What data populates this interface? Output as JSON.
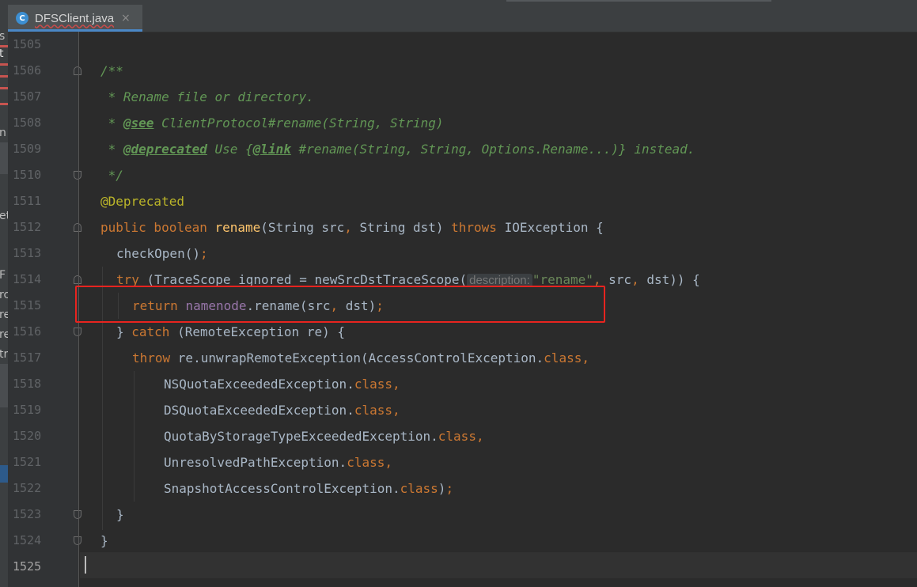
{
  "tab": {
    "icon_letter": "C",
    "filename": "DFSClient.java",
    "close_glyph": "×",
    "icon": "class-c-icon",
    "accent": "#4a88c7"
  },
  "left_strip": {
    "fragments": [
      "s",
      "t",
      "n",
      "et",
      "F",
      "rc",
      "re",
      "re",
      "tr"
    ]
  },
  "editor": {
    "current_line": "1525",
    "colors": {
      "keyword": "#cc7832",
      "doc_comment": "#629755",
      "annotation": "#bbb529",
      "method": "#ffc66d",
      "string": "#6a8759",
      "field": "#9876aa",
      "highlight_box": "#e8241f"
    },
    "line_numbers": [
      "1505",
      "1506",
      "1507",
      "1508",
      "1509",
      "1510",
      "1511",
      "1512",
      "1513",
      "1514",
      "1515",
      "1516",
      "1517",
      "1518",
      "1519",
      "1520",
      "1521",
      "1522",
      "1523",
      "1524",
      "1525"
    ],
    "code": {
      "l1506": "/**",
      "l1507": " * Rename file or directory.",
      "l1508a": " * ",
      "l1508tag": "@see",
      "l1508b": " ClientProtocol#rename(String, String)",
      "l1509a": " * ",
      "l1509tag": "@deprecated",
      "l1509b": " Use {",
      "l1509link": "@link",
      "l1509c": " #rename(String, String, Options.Rename...)} instead.",
      "l1510": " */",
      "l1511": "@Deprecated",
      "l1512kw": "public boolean ",
      "l1512fn": "rename",
      "l1512a": "(String src",
      "l1512comma": ", ",
      "l1512b": "String dst) ",
      "l1512throws": "throws ",
      "l1512c": "IOException {",
      "l1513a": "checkOpen()",
      "l1513semi": ";",
      "l1514kw": "try ",
      "l1514a": "(TraceScope ignored = newSrcDstTraceScope(",
      "l1514hint": "description:",
      "l1514str": "\"rename\"",
      "l1514comma": ", ",
      "l1514b": "src",
      "l1514comma2": ", ",
      "l1514c": "dst)) {",
      "l1515kw": "return ",
      "l1515fld": "namenode",
      "l1515a": ".rename(src",
      "l1515comma": ", ",
      "l1515b": "dst)",
      "l1515semi": ";",
      "l1516a": "} ",
      "l1516kw": "catch ",
      "l1516b": "(RemoteException re) {",
      "l1517kw": "throw ",
      "l1517a": "re.unwrapRemoteException(AccessControlException.",
      "l1517cls": "class,",
      "l1518a": "NSQuotaExceededException.",
      "l1518cls": "class,",
      "l1519a": "DSQuotaExceededException.",
      "l1519cls": "class,",
      "l1520a": "QuotaByStorageTypeExceededException.",
      "l1520cls": "class,",
      "l1521a": "UnresolvedPathException.",
      "l1521cls": "class,",
      "l1522a": "SnapshotAccessControlException.",
      "l1522cls": "class",
      "l1522b": ")",
      "l1522semi": ";",
      "l1523": "}",
      "l1524": "}"
    }
  }
}
